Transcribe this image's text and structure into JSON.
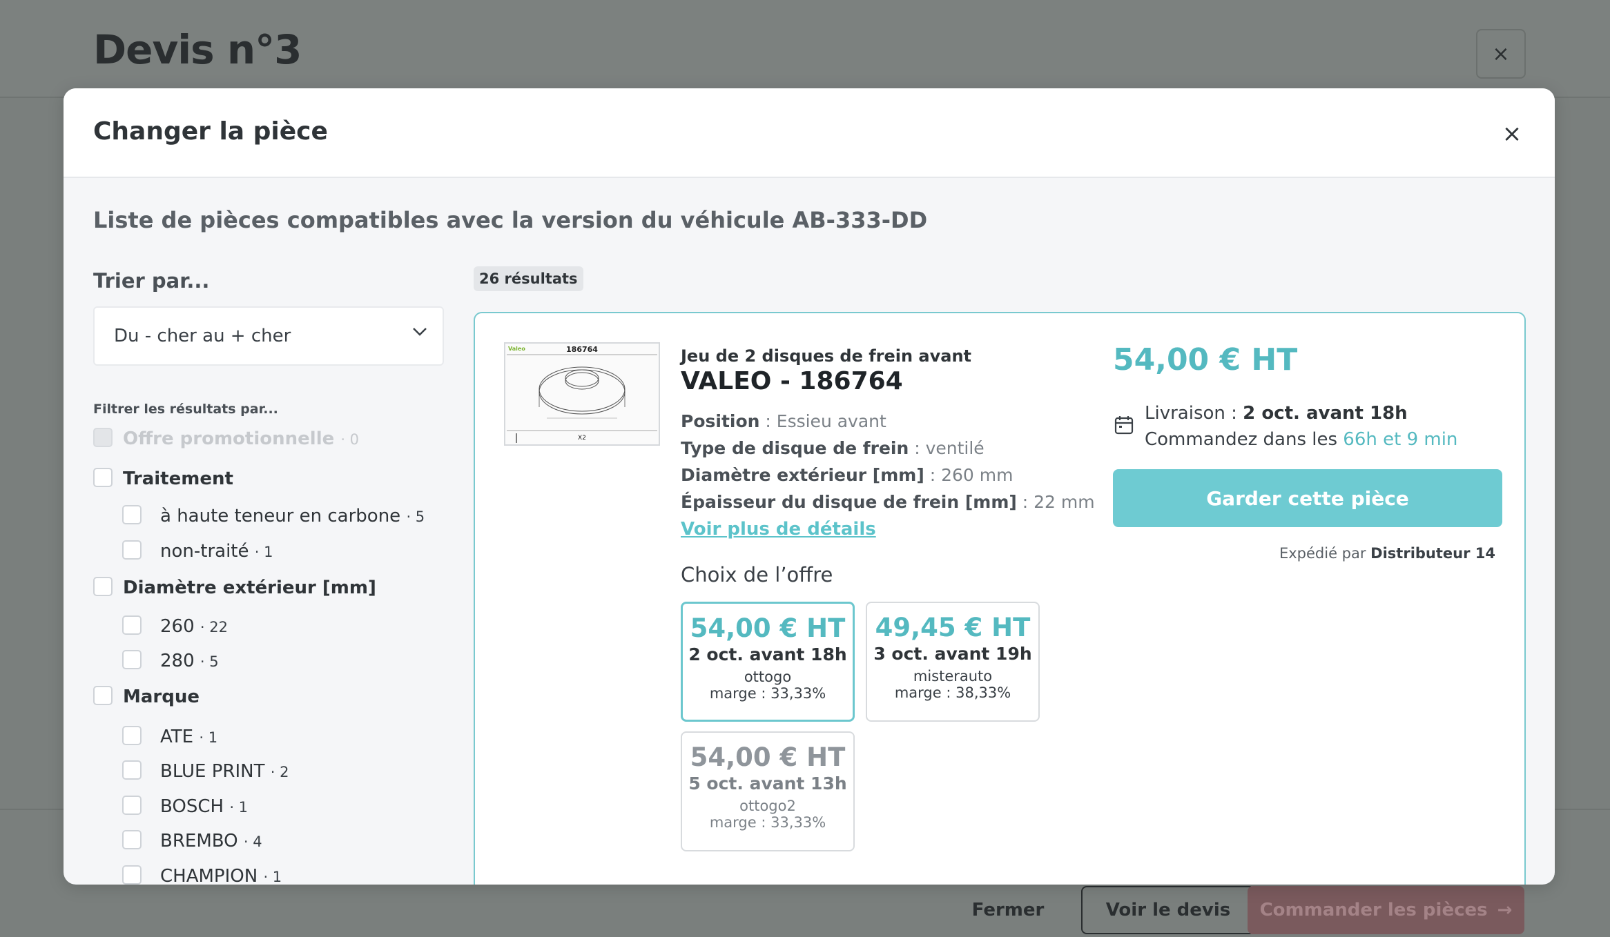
{
  "background": {
    "title": "Devis n°3",
    "close_icon": "×",
    "footer": {
      "fermer": "Fermer",
      "voir_devis": "Voir le devis",
      "commander": "Commander les pièces",
      "arrow_icon": "→"
    }
  },
  "modal": {
    "title": "Changer la pièce",
    "close_icon": "×",
    "subtitle": "Liste de pièces compatibles avec la version du véhicule AB-333-DD"
  },
  "sort": {
    "label": "Trier par...",
    "selected": "Du - cher au + cher",
    "chevron_icon": "⌄"
  },
  "filters": {
    "label": "Filtrer les résultats par...",
    "promo": {
      "label": "Offre promotionnelle",
      "count": "· 0"
    },
    "traitement": {
      "label": "Traitement",
      "items": [
        {
          "label": "à haute teneur en carbone",
          "count": "· 5"
        },
        {
          "label": "non-traité",
          "count": "· 1"
        }
      ]
    },
    "diametre": {
      "label": "Diamètre extérieur [mm]",
      "items": [
        {
          "label": "260",
          "count": "· 22"
        },
        {
          "label": "280",
          "count": "· 5"
        }
      ]
    },
    "marque": {
      "label": "Marque",
      "items": [
        {
          "label": "ATE",
          "count": "· 1"
        },
        {
          "label": "BLUE PRINT",
          "count": "· 2"
        },
        {
          "label": "BOSCH",
          "count": "· 1"
        },
        {
          "label": "BREMBO",
          "count": "· 4"
        },
        {
          "label": "CHAMPION",
          "count": "· 1"
        }
      ]
    }
  },
  "results": {
    "count": "26 résultats"
  },
  "product": {
    "image_label": "186764",
    "image_sub": "X2",
    "image_brand": "Valeo",
    "subtitle": "Jeu de 2 disques de frein avant",
    "title": "VALEO - 186764",
    "attributes": [
      {
        "name": "Position",
        "value": " : Essieu avant"
      },
      {
        "name": "Type de disque de frein",
        "value": " : ventilé"
      },
      {
        "name": "Diamètre extérieur [mm]",
        "value": " : 260 mm"
      },
      {
        "name": "Épaisseur du disque de frein [mm]",
        "value": " : 22 mm"
      }
    ],
    "details_link": "Voir plus de détails",
    "offer_heading": "Choix de l’offre",
    "offers": [
      {
        "price": "54,00 € HT",
        "date": "2 oct. avant 18h",
        "distributor": "ottogo",
        "marge": "marge : 33,33%"
      },
      {
        "price": "49,45 € HT",
        "date": "3 oct. avant 19h",
        "distributor": "misterauto",
        "marge": "marge : 38,33%"
      },
      {
        "price": "54,00 € HT",
        "date": "5 oct. avant 13h",
        "distributor": "ottogo2",
        "marge": "marge : 33,33%"
      }
    ],
    "price": "54,00 € HT",
    "calendar_icon": "calendar-icon",
    "delivery_label": "Livraison : ",
    "delivery_value": "2 oct. avant 18h",
    "order_prefix": "Commandez dans les ",
    "order_countdown": "66h et 9 min",
    "keep_button": "Garder cette pièce",
    "shipped_prefix": "Expédié par ",
    "shipped_by": "Distributeur 14"
  },
  "colors": {
    "accent": "#54b9c0",
    "button": "#6ecbd2",
    "commander_bg": "#7a5a5d"
  }
}
